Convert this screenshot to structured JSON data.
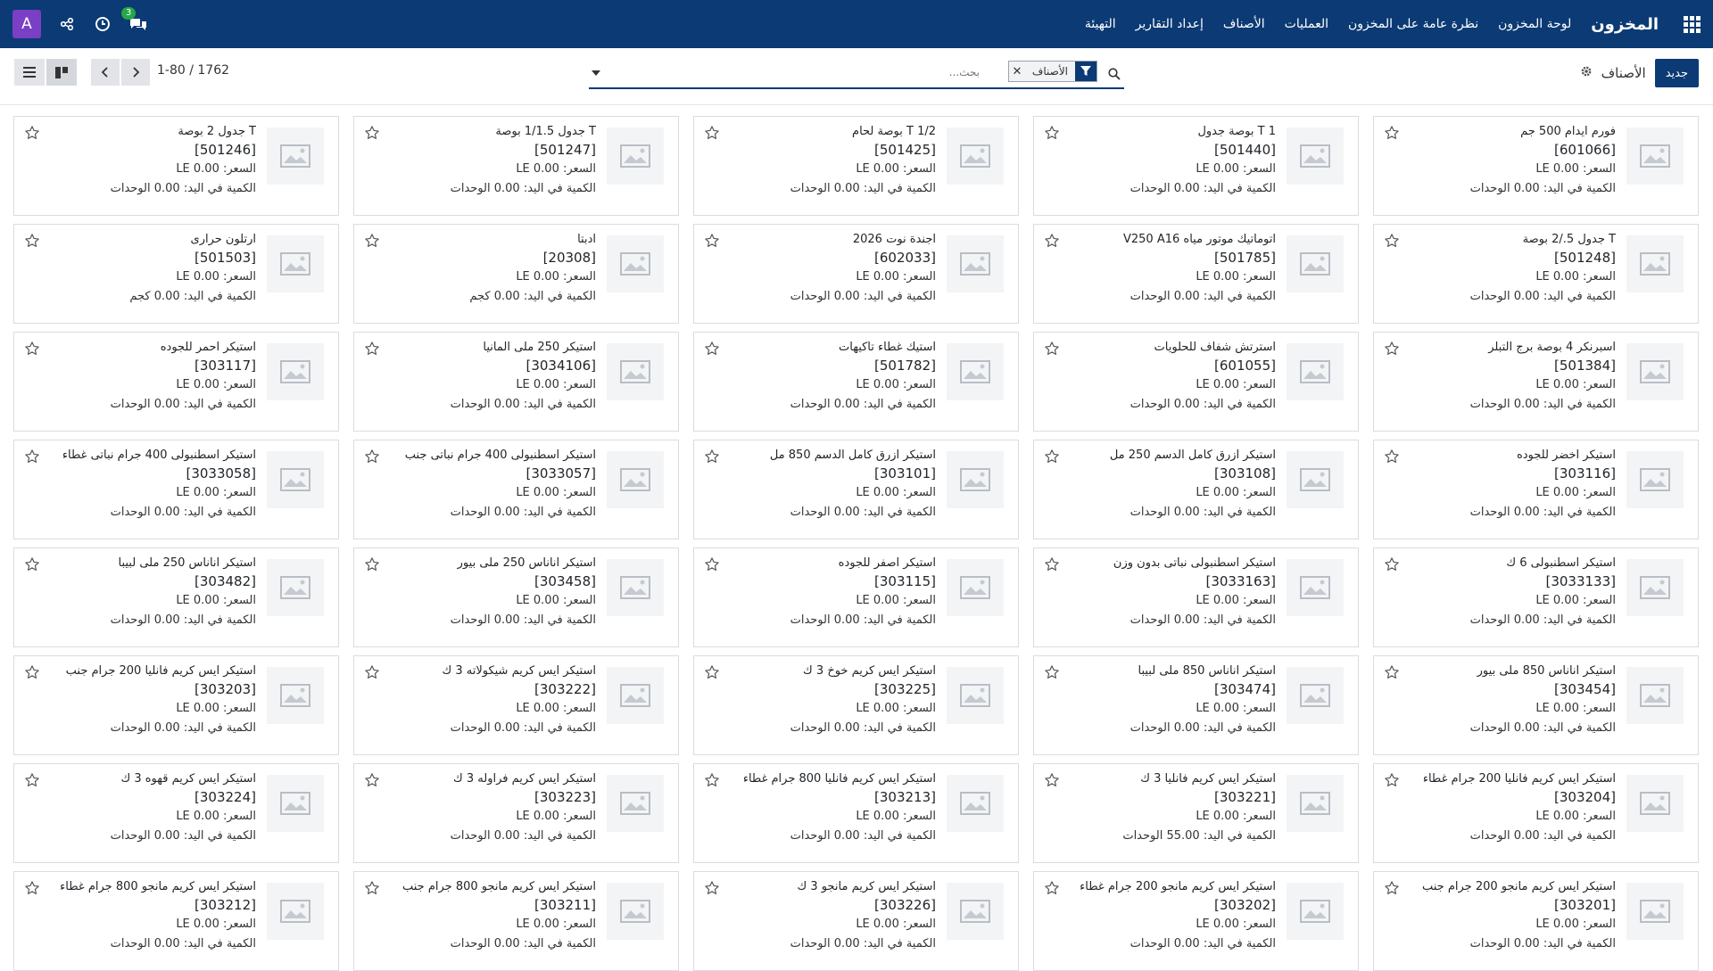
{
  "navbar": {
    "app_title": "المخزون",
    "menu": [
      "لوحة المخزون",
      "نظرة عامة على المخزون",
      "العمليات",
      "الأصناف",
      "إعداد التقارير",
      "التهيئة"
    ],
    "avatar_letter": "A",
    "messages_count": "3",
    "bg_color": "#0b3a74"
  },
  "control": {
    "new_button": "جديد",
    "breadcrumb": "الأصناف",
    "search": {
      "facet_label": "الأصناف",
      "placeholder": "بحث..."
    },
    "pager": "1-80 / 1762"
  },
  "labels": {
    "price_prefix": "السعر: LE ",
    "qty_prefix": "الكمية في اليد: "
  },
  "products": [
    {
      "name": "فورم ايدام 500 جم",
      "code": "[601066]",
      "price": "0.00",
      "qty": "0.00",
      "unit": "الوحدات"
    },
    {
      "name": "T 1 بوصة جدول",
      "code": "[501440]",
      "price": "0.00",
      "qty": "0.00",
      "unit": "الوحدات"
    },
    {
      "name": "T 1/2 بوصة لحام",
      "code": "[501425]",
      "price": "0.00",
      "qty": "0.00",
      "unit": "الوحدات"
    },
    {
      "name": "T جدول 1/1.5 بوصة",
      "code": "[501247]",
      "price": "0.00",
      "qty": "0.00",
      "unit": "الوحدات"
    },
    {
      "name": "T جدول 2 بوصة",
      "code": "[501246]",
      "price": "0.00",
      "qty": "0.00",
      "unit": "الوحدات"
    },
    {
      "name": "T جدول 5./2 بوصة",
      "code": "[501248]",
      "price": "0.00",
      "qty": "0.00",
      "unit": "الوحدات"
    },
    {
      "name": "اتوماتيك موتور مياه V250 A16",
      "code": "[501785]",
      "price": "0.00",
      "qty": "0.00",
      "unit": "الوحدات"
    },
    {
      "name": "اجندة نوت 2026",
      "code": "[602033]",
      "price": "0.00",
      "qty": "0.00",
      "unit": "الوحدات"
    },
    {
      "name": "ادبتا",
      "code": "[20308]",
      "price": "0.00",
      "qty": "0.00",
      "unit": "كجم"
    },
    {
      "name": "ارتلون حرارى",
      "code": "[501503]",
      "price": "0.00",
      "qty": "0.00",
      "unit": "كجم"
    },
    {
      "name": "اسبرنكر 4 بوصة برج التبلر",
      "code": "[501384]",
      "price": "0.00",
      "qty": "0.00",
      "unit": "الوحدات"
    },
    {
      "name": "استرتش شفاف للحلويات",
      "code": "[601055]",
      "price": "0.00",
      "qty": "0.00",
      "unit": "الوحدات"
    },
    {
      "name": "استيك غطاء تاكيهات",
      "code": "[501782]",
      "price": "0.00",
      "qty": "0.00",
      "unit": "الوحدات"
    },
    {
      "name": "استيكر 250 ملى المانيا",
      "code": "[3034106]",
      "price": "0.00",
      "qty": "0.00",
      "unit": "الوحدات"
    },
    {
      "name": "استيكر احمر للجوده",
      "code": "[303117]",
      "price": "0.00",
      "qty": "0.00",
      "unit": "الوحدات"
    },
    {
      "name": "استيكر اخضر للجوده",
      "code": "[303116]",
      "price": "0.00",
      "qty": "0.00",
      "unit": "الوحدات"
    },
    {
      "name": "استيكر ازرق كامل الدسم 250 مل",
      "code": "[303108]",
      "price": "0.00",
      "qty": "0.00",
      "unit": "الوحدات"
    },
    {
      "name": "استيكر ازرق كامل الدسم 850 مل",
      "code": "[303101]",
      "price": "0.00",
      "qty": "0.00",
      "unit": "الوحدات"
    },
    {
      "name": "استيكر اسطنبولى 400 جرام نباتى جنب",
      "code": "[3033057]",
      "price": "0.00",
      "qty": "0.00",
      "unit": "الوحدات"
    },
    {
      "name": "استيكر اسطنبولى 400 جرام نباتى غطاء",
      "code": "[3033058]",
      "price": "0.00",
      "qty": "0.00",
      "unit": "الوحدات"
    },
    {
      "name": "استيكر اسطنبولى 6 ك",
      "code": "[3033133]",
      "price": "0.00",
      "qty": "0.00",
      "unit": "الوحدات"
    },
    {
      "name": "استيكر اسطنبولى نباتى بدون وزن",
      "code": "[3033163]",
      "price": "0.00",
      "qty": "0.00",
      "unit": "الوحدات"
    },
    {
      "name": "استيكر اصفر للجوده",
      "code": "[303115]",
      "price": "0.00",
      "qty": "0.00",
      "unit": "الوحدات"
    },
    {
      "name": "استيكر اناناس 250 ملى بيور",
      "code": "[303458]",
      "price": "0.00",
      "qty": "0.00",
      "unit": "الوحدات"
    },
    {
      "name": "استيكر اناناس 250 ملى لبيبا",
      "code": "[303482]",
      "price": "0.00",
      "qty": "0.00",
      "unit": "الوحدات"
    },
    {
      "name": "استيكر اناناس 850 ملى بيور",
      "code": "[303454]",
      "price": "0.00",
      "qty": "0.00",
      "unit": "الوحدات"
    },
    {
      "name": "استيكر اناناس 850 ملى لبيبا",
      "code": "[303474]",
      "price": "0.00",
      "qty": "0.00",
      "unit": "الوحدات"
    },
    {
      "name": "استيكر ايس كريم خوخ 3 ك",
      "code": "[303225]",
      "price": "0.00",
      "qty": "0.00",
      "unit": "الوحدات"
    },
    {
      "name": "استيكر ايس كريم شيكولاته 3 ك",
      "code": "[303222]",
      "price": "0.00",
      "qty": "0.00",
      "unit": "الوحدات"
    },
    {
      "name": "استيكر ايس كريم فانليا 200 جرام جنب",
      "code": "[303203]",
      "price": "0.00",
      "qty": "0.00",
      "unit": "الوحدات"
    },
    {
      "name": "استيكر ايس كريم فانليا 200 جرام غطاء",
      "code": "[303204]",
      "price": "0.00",
      "qty": "0.00",
      "unit": "الوحدات"
    },
    {
      "name": "استيكر ايس كريم فانليا 3 ك",
      "code": "[303221]",
      "price": "0.00",
      "qty": "55.00",
      "unit": "الوحدات"
    },
    {
      "name": "استيكر ايس كريم فانليا 800 جرام غطاء",
      "code": "[303213]",
      "price": "0.00",
      "qty": "0.00",
      "unit": "الوحدات"
    },
    {
      "name": "استيكر ايس كريم فراوله 3 ك",
      "code": "[303223]",
      "price": "0.00",
      "qty": "0.00",
      "unit": "الوحدات"
    },
    {
      "name": "استيكر ايس كريم قهوه 3 ك",
      "code": "[303224]",
      "price": "0.00",
      "qty": "0.00",
      "unit": "الوحدات"
    },
    {
      "name": "استيكر ايس كريم مانجو 200 جرام جنب",
      "code": "[303201]",
      "price": "0.00",
      "qty": "0.00",
      "unit": "الوحدات"
    },
    {
      "name": "استيكر ايس كريم مانجو 200 جرام غطاء",
      "code": "[303202]",
      "price": "0.00",
      "qty": "0.00",
      "unit": "الوحدات"
    },
    {
      "name": "استيكر ايس كريم مانجو 3 ك",
      "code": "[303226]",
      "price": "0.00",
      "qty": "0.00",
      "unit": "الوحدات"
    },
    {
      "name": "استيكر ايس كريم مانجو 800 جرام جنب",
      "code": "[303211]",
      "price": "0.00",
      "qty": "0.00",
      "unit": "الوحدات"
    },
    {
      "name": "استيكر ايس كريم مانجو 800 جرام غطاء",
      "code": "[303212]",
      "price": "0.00",
      "qty": "0.00",
      "unit": "الوحدات"
    }
  ]
}
